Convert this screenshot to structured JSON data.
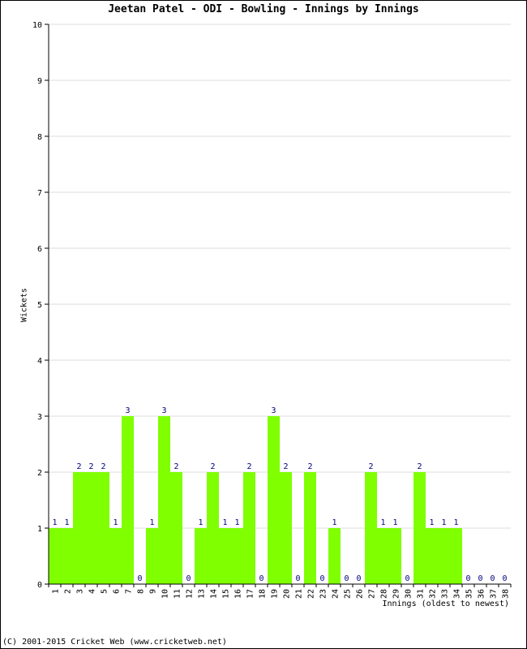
{
  "chart_data": {
    "type": "bar",
    "title": "Jeetan Patel - ODI - Bowling - Innings by Innings",
    "xlabel": "Innings (oldest to newest)",
    "ylabel": "Wickets",
    "ylim": [
      0,
      10
    ],
    "yticks": [
      0,
      1,
      2,
      3,
      4,
      5,
      6,
      7,
      8,
      9,
      10
    ],
    "grid": true,
    "bar_color": "#7fff00",
    "label_color": "#000080",
    "categories": [
      "1",
      "2",
      "3",
      "4",
      "5",
      "6",
      "7",
      "8",
      "9",
      "10",
      "11",
      "12",
      "13",
      "14",
      "15",
      "16",
      "17",
      "18",
      "19",
      "20",
      "21",
      "22",
      "23",
      "24",
      "25",
      "26",
      "27",
      "28",
      "29",
      "30",
      "31",
      "32",
      "33",
      "34",
      "35",
      "36",
      "37",
      "38"
    ],
    "values": [
      1,
      1,
      2,
      2,
      2,
      1,
      3,
      0,
      1,
      3,
      2,
      0,
      1,
      2,
      1,
      1,
      2,
      0,
      3,
      2,
      0,
      2,
      0,
      1,
      0,
      0,
      2,
      1,
      1,
      0,
      2,
      1,
      1,
      1,
      0,
      0,
      0,
      0
    ]
  },
  "footer": {
    "copyright": "(C) 2001-2015 Cricket Web (www.cricketweb.net)"
  }
}
